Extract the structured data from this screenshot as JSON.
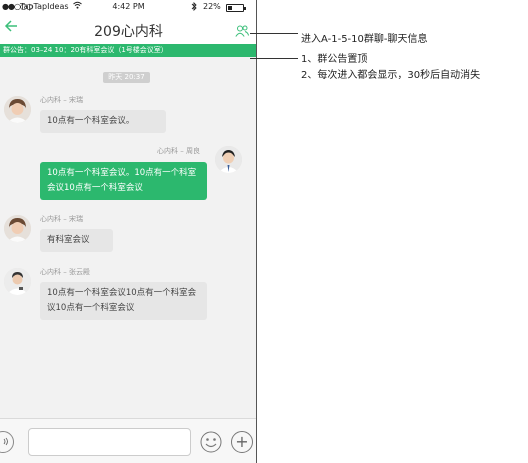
{
  "status_bar": {
    "signal": "●●○○○",
    "carrier": "TapTapIdeas",
    "time": "4:42 PM",
    "battery": "22%"
  },
  "nav": {
    "back_icon": "arrow-left-icon",
    "title": "209心内科",
    "group_icon": "group-users-icon",
    "accent_color": "#3cbf7a"
  },
  "notice": {
    "text": "群公告：03–24 10：20有科室会议（1号楼会议室）",
    "color": "#2cb86e"
  },
  "time_divider": "昨天 20:37",
  "messages": [
    {
      "sender": "心内科 – 宋瑞",
      "text": "10点有一个科室会议。",
      "direction": "in"
    },
    {
      "sender": "心内科 – 周良",
      "text": "10点有一个科室会议。10点有一个科室会议10点有一个科室会议",
      "direction": "out"
    },
    {
      "sender": "心内科 – 宋瑞",
      "text": "有科室会议",
      "direction": "in"
    },
    {
      "sender": "心内科 – 张云殿",
      "text": "10点有一个科室会议10点有一个科室会议10点有一个科室会议",
      "direction": "in"
    }
  ],
  "input_bar": {
    "voice_icon": "voice-icon",
    "emoji_icon": "emoji-icon",
    "plus_icon": "plus-icon",
    "placeholder": ""
  },
  "annotations": {
    "group_info": "进入A-1-5-10群聊-聊天信息",
    "notice_line1": "1、群公告置顶",
    "notice_line2": "2、每次进入都会显示，30秒后自动消失"
  }
}
